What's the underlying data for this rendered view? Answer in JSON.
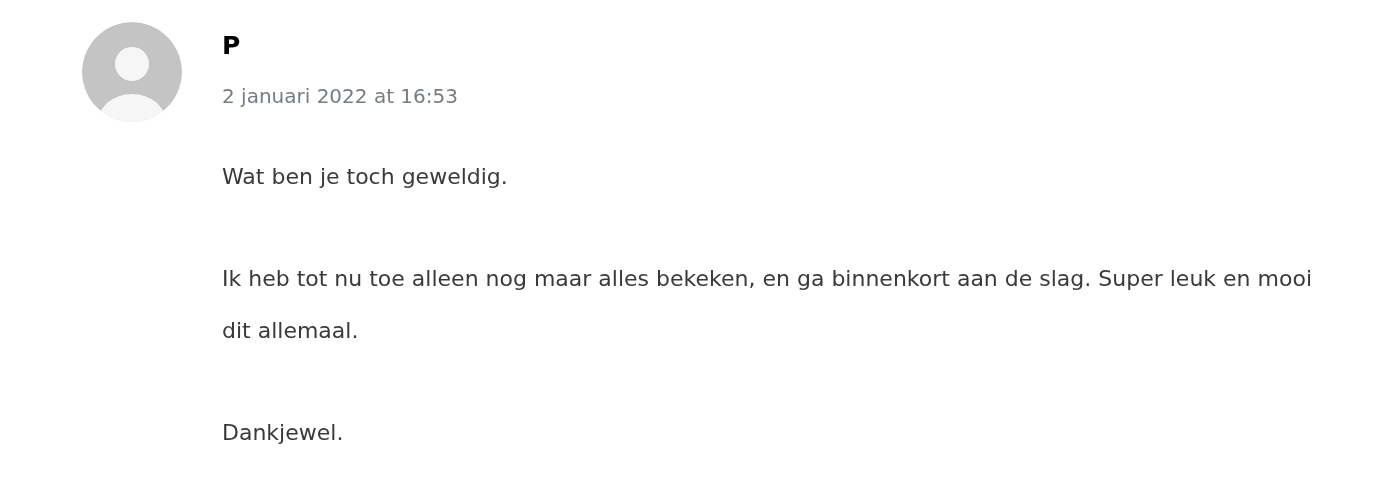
{
  "comment": {
    "author": "P",
    "date": "2 januari 2022 at 16:53",
    "paragraphs": [
      "Wat ben je toch geweldig.",
      "Ik heb tot nu toe alleen nog maar alles bekeken, en ga binnenkort aan de slag. Super leuk en mooi dit allemaal.",
      "Dankjewel."
    ]
  }
}
